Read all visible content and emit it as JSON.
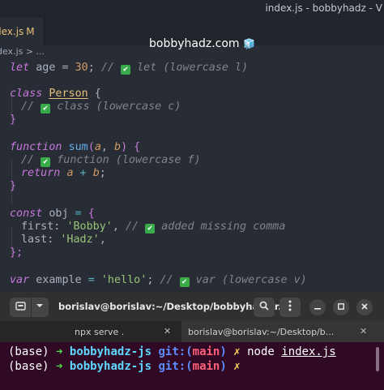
{
  "editor": {
    "window_title": "index.js - bobbyhadz - V",
    "tab": {
      "label": "dex.js",
      "state": "M"
    },
    "banner": {
      "text": "bobbyhadz.com",
      "emoji": "🧊"
    },
    "breadcrumb": "dex.js > ...",
    "code": {
      "l1": {
        "kw": "let",
        "ident": " age = ",
        "num": "30",
        "semi": ";",
        "cmt_a": " // ",
        "cmt_b": " let (lowercase l)"
      },
      "l2": {
        "kw": "class",
        "cls": "Person",
        "brace": " {"
      },
      "l3": {
        "cmt_a": "// ",
        "cmt_b": " class (lowercase c)"
      },
      "l4": {
        "brace": "}"
      },
      "l5": {
        "kw": "function",
        "fn": "sum",
        "p_open": "(",
        "a": "a",
        "comma": ", ",
        "b": "b",
        "p_close": ") {"
      },
      "l6": {
        "cmt_a": "// ",
        "cmt_b": " function (lowercase f)"
      },
      "l7": {
        "kw": "return",
        "a": "a",
        "plus": " + ",
        "b": "b",
        "semi": ";"
      },
      "l8": {
        "brace": "}"
      },
      "l9": {
        "kw": "const",
        "ident": " obj ",
        "eq": "=",
        "brace": " {"
      },
      "l10": {
        "key": "first: ",
        "str": "'Bobby'",
        "comma": ", ",
        "cmt_a": "// ",
        "cmt_b": " added missing comma"
      },
      "l11": {
        "key": "last: ",
        "str": "'Hadz'",
        "comma": ","
      },
      "l12": {
        "brace": "};"
      },
      "l13": {
        "kw": "var",
        "ident": " example ",
        "eq": "=",
        "space": " ",
        "str": "'hello'",
        "semi": "; ",
        "cmt_a": "// ",
        "cmt_b": " var (lowercase v)"
      }
    }
  },
  "terminal": {
    "title": "borislav@borislav:~/Desktop/bobbyhadz-r...",
    "tabs": [
      {
        "label": "npx serve ."
      },
      {
        "label": "borislav@borislav:~/Desktop/b..."
      }
    ],
    "lines": [
      {
        "env": "(base) ",
        "arrow": "➜",
        "dir": "bobbyhadz-js",
        "git": "git:(",
        "branch": "main",
        "git_end": ")",
        "x": "✗",
        "cmd": "node",
        "arg": "index.js"
      },
      {
        "env": "(base) ",
        "arrow": "➜",
        "dir": "bobbyhadz-js",
        "git": "git:(",
        "branch": "main",
        "git_end": ")",
        "x": "✗"
      }
    ]
  },
  "icons": {
    "check": "check-mark-icon",
    "new_tab": "new-tab-icon",
    "dropdown": "chevron-down-icon",
    "search": "search-icon",
    "menu": "kebab-menu-icon",
    "minimize": "minimize-icon",
    "maximize": "maximize-icon",
    "close": "close-icon"
  },
  "colors": {
    "editor_bg": "#282c34",
    "terminal_bg": "#300a24",
    "keyword": "#c678dd",
    "string": "#98c379",
    "number": "#d19a66",
    "comment": "#7f848e",
    "class": "#e5c07b",
    "function": "#61afef",
    "prompt_arrow": "#4ee24e",
    "prompt_dir": "#5fd7ff",
    "prompt_branch": "#ff5f7a"
  }
}
